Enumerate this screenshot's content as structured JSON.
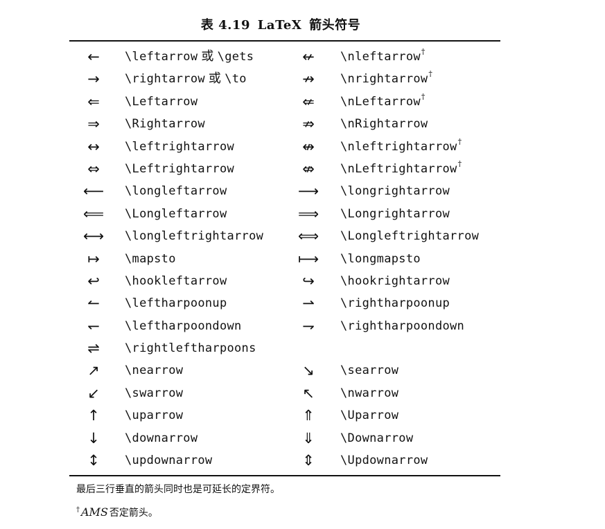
{
  "caption": {
    "prefix": "表 4.19",
    "latex": "LaTeX",
    "suffix": "箭头符号"
  },
  "dagger": "†",
  "or_word": "或",
  "rows": [
    {
      "ls": "←",
      "lc": "\\leftarrow",
      "lor": "\\gets",
      "rs": "↚",
      "rc": "\\nleftarrow",
      "rdag": true
    },
    {
      "ls": "→",
      "lc": "\\rightarrow",
      "lor": "\\to",
      "rs": "↛",
      "rc": "\\nrightarrow",
      "rdag": true
    },
    {
      "ls": "⇐",
      "lc": "\\Leftarrow",
      "rs": "⇍",
      "rc": "\\nLeftarrow",
      "rdag": true
    },
    {
      "ls": "⇒",
      "lc": "\\Rightarrow",
      "rs": "⇏",
      "rc": "\\nRightarrow"
    },
    {
      "ls": "↔",
      "lc": "\\leftrightarrow",
      "rs": "↮",
      "rc": "\\nleftrightarrow",
      "rdag": true
    },
    {
      "ls": "⇔",
      "lc": "\\Leftrightarrow",
      "rs": "⇎",
      "rc": "\\nLeftrightarrow",
      "rdag": true
    },
    {
      "ls": "⟵",
      "lc": "\\longleftarrow",
      "rs": "⟶",
      "rc": "\\longrightarrow"
    },
    {
      "ls": "⟸",
      "lc": "\\Longleftarrow",
      "rs": "⟹",
      "rc": "\\Longrightarrow"
    },
    {
      "ls": "⟷",
      "lc": "\\longleftrightarrow",
      "rs": "⟺",
      "rc": "\\Longleftrightarrow"
    },
    {
      "ls": "↦",
      "lc": "\\mapsto",
      "rs": "⟼",
      "rc": "\\longmapsto"
    },
    {
      "ls": "↩",
      "lc": "\\hookleftarrow",
      "rs": "↪",
      "rc": "\\hookrightarrow"
    },
    {
      "ls": "↼",
      "lc": "\\leftharpoonup",
      "rs": "⇀",
      "rc": "\\rightharpoonup"
    },
    {
      "ls": "↽",
      "lc": "\\leftharpoondown",
      "rs": "⇁",
      "rc": "\\rightharpoondown"
    },
    {
      "ls": "⇌",
      "lc": "\\rightleftharpoons",
      "rs": "",
      "rc": ""
    },
    {
      "ls": "↗",
      "lc": "\\nearrow",
      "rs": "↘",
      "rc": "\\searrow"
    },
    {
      "ls": "↙",
      "lc": "\\swarrow",
      "rs": "↖",
      "rc": "\\nwarrow"
    },
    {
      "ls": "↑",
      "lc": "\\uparrow",
      "rs": "⇑",
      "rc": "\\Uparrow"
    },
    {
      "ls": "↓",
      "lc": "\\downarrow",
      "rs": "⇓",
      "rc": "\\Downarrow"
    },
    {
      "ls": "↕",
      "lc": "\\updownarrow",
      "rs": "⇕",
      "rc": "\\Updownarrow"
    }
  ],
  "notes": {
    "delim": "最后三行垂直的箭头同时也是可延长的定界符。",
    "ams_mark": "†",
    "ams_name": "AMS",
    "ams_text": "否定箭头。"
  }
}
